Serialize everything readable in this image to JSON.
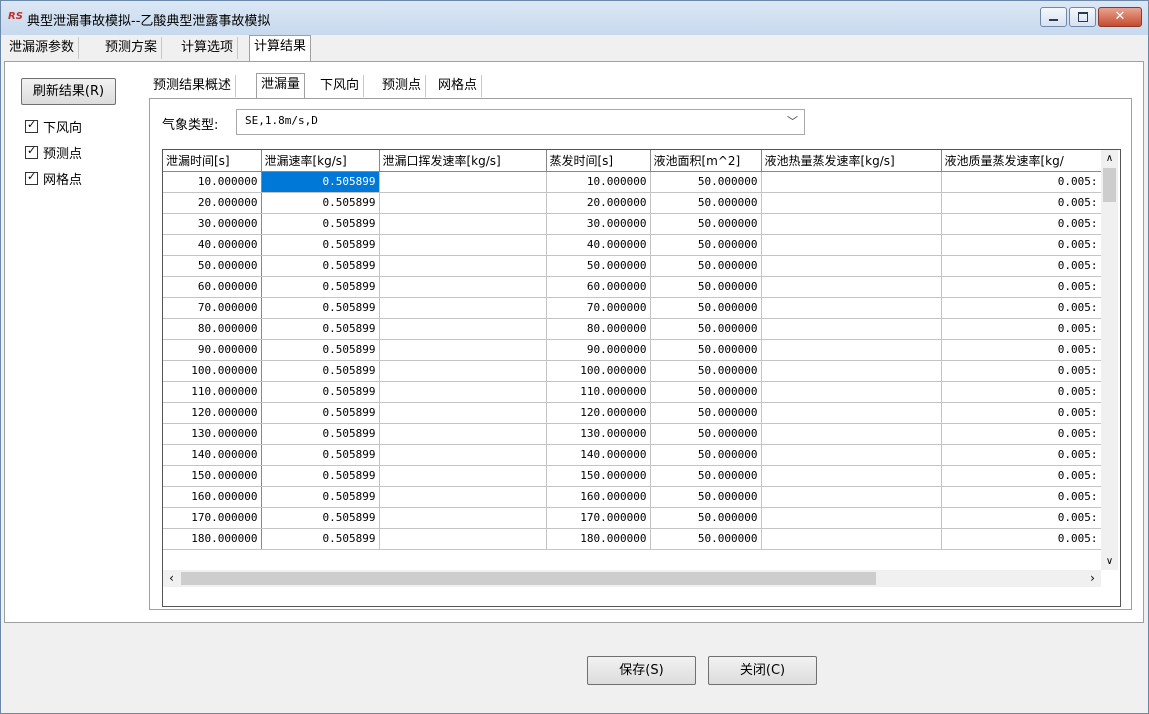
{
  "window": {
    "title": "典型泄漏事故模拟--乙酸典型泄露事故模拟",
    "app_icon_text": "RS",
    "close_glyph": "✕"
  },
  "main_tabs": [
    {
      "label": "泄漏源参数"
    },
    {
      "label": "预测方案"
    },
    {
      "label": "计算选项"
    },
    {
      "label": "计算结果"
    }
  ],
  "active_main_tab": "计算结果",
  "left_panel": {
    "refresh_label": "刷新结果(R)",
    "checkboxes": [
      {
        "label": "下风向",
        "checked": true
      },
      {
        "label": "预测点",
        "checked": true
      },
      {
        "label": "网格点",
        "checked": true
      }
    ]
  },
  "sub_tabs": [
    {
      "label": "预测结果概述"
    },
    {
      "label": "泄漏量"
    },
    {
      "label": "下风向"
    },
    {
      "label": "预测点"
    },
    {
      "label": "网格点"
    }
  ],
  "active_sub_tab": "泄漏量",
  "weather": {
    "label": "气象类型:",
    "value": "SE,1.8m/s,D"
  },
  "grid": {
    "columns": [
      "泄漏时间[s]",
      "泄漏速率[kg/s]",
      "泄漏口挥发速率[kg/s]",
      "蒸发时间[s]",
      "液池面积[m^2]",
      "液池热量蒸发速率[kg/s]",
      "液池质量蒸发速率[kg/"
    ],
    "rows": [
      [
        "10.000000",
        "0.505899",
        "",
        "10.000000",
        "50.000000",
        "",
        "0.005:"
      ],
      [
        "20.000000",
        "0.505899",
        "",
        "20.000000",
        "50.000000",
        "",
        "0.005:"
      ],
      [
        "30.000000",
        "0.505899",
        "",
        "30.000000",
        "50.000000",
        "",
        "0.005:"
      ],
      [
        "40.000000",
        "0.505899",
        "",
        "40.000000",
        "50.000000",
        "",
        "0.005:"
      ],
      [
        "50.000000",
        "0.505899",
        "",
        "50.000000",
        "50.000000",
        "",
        "0.005:"
      ],
      [
        "60.000000",
        "0.505899",
        "",
        "60.000000",
        "50.000000",
        "",
        "0.005:"
      ],
      [
        "70.000000",
        "0.505899",
        "",
        "70.000000",
        "50.000000",
        "",
        "0.005:"
      ],
      [
        "80.000000",
        "0.505899",
        "",
        "80.000000",
        "50.000000",
        "",
        "0.005:"
      ],
      [
        "90.000000",
        "0.505899",
        "",
        "90.000000",
        "50.000000",
        "",
        "0.005:"
      ],
      [
        "100.000000",
        "0.505899",
        "",
        "100.000000",
        "50.000000",
        "",
        "0.005:"
      ],
      [
        "110.000000",
        "0.505899",
        "",
        "110.000000",
        "50.000000",
        "",
        "0.005:"
      ],
      [
        "120.000000",
        "0.505899",
        "",
        "120.000000",
        "50.000000",
        "",
        "0.005:"
      ],
      [
        "130.000000",
        "0.505899",
        "",
        "130.000000",
        "50.000000",
        "",
        "0.005:"
      ],
      [
        "140.000000",
        "0.505899",
        "",
        "140.000000",
        "50.000000",
        "",
        "0.005:"
      ],
      [
        "150.000000",
        "0.505899",
        "",
        "150.000000",
        "50.000000",
        "",
        "0.005:"
      ],
      [
        "160.000000",
        "0.505899",
        "",
        "160.000000",
        "50.000000",
        "",
        "0.005:"
      ],
      [
        "170.000000",
        "0.505899",
        "",
        "170.000000",
        "50.000000",
        "",
        "0.005:"
      ],
      [
        "180.000000",
        "0.505899",
        "",
        "180.000000",
        "50.000000",
        "",
        "0.005:"
      ]
    ],
    "selected_cell": [
      0,
      1
    ]
  },
  "footer": {
    "save_label": "保存(S)",
    "close_label": "关闭(C)"
  },
  "colors": {
    "selection": "#0078d7",
    "close_button": "#c74c2e",
    "titlebar": "#dbe7f5"
  },
  "icons": [
    "app-logo-icon",
    "minimize-icon",
    "maximize-icon",
    "close-icon",
    "checkbox-icon",
    "dropdown-arrow-icon",
    "scroll-up-icon",
    "scroll-down-icon",
    "scroll-left-icon",
    "scroll-right-icon"
  ]
}
